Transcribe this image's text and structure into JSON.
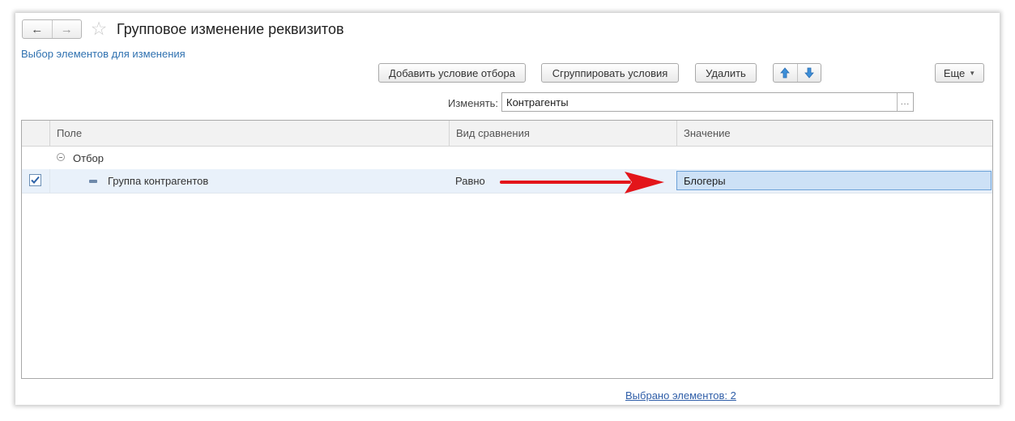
{
  "window": {
    "title": "Групповое изменение реквизитов",
    "section_link": "Выбор элементов для изменения"
  },
  "nav": {
    "back_icon": "arrow-left-icon",
    "forward_icon": "arrow-right-icon",
    "favorite_icon": "star-icon"
  },
  "toolbar": {
    "add_condition": "Добавить условие отбора",
    "group_conditions": "Сгруппировать условия",
    "delete": "Удалить",
    "move_up_icon": "arrow-up-icon",
    "move_down_icon": "arrow-down-icon",
    "more": "Еще"
  },
  "change_field": {
    "label": "Изменять:",
    "value": "Контрагенты",
    "select_glyph": "..."
  },
  "grid": {
    "columns": [
      "Поле",
      "Вид сравнения",
      "Значение"
    ],
    "group_row": {
      "label": "Отбор"
    },
    "rows": [
      {
        "checked": true,
        "field": "Группа контрагентов",
        "comparison": "Равно",
        "value": "Блогеры"
      }
    ]
  },
  "footer": {
    "selected_count": "Выбрано элементов: 2"
  },
  "colors": {
    "link": "#2f71b0",
    "selection": "#cde1f6",
    "annotation_arrow": "#e3151a",
    "arrow_button_icon": "#3d8fd9"
  }
}
